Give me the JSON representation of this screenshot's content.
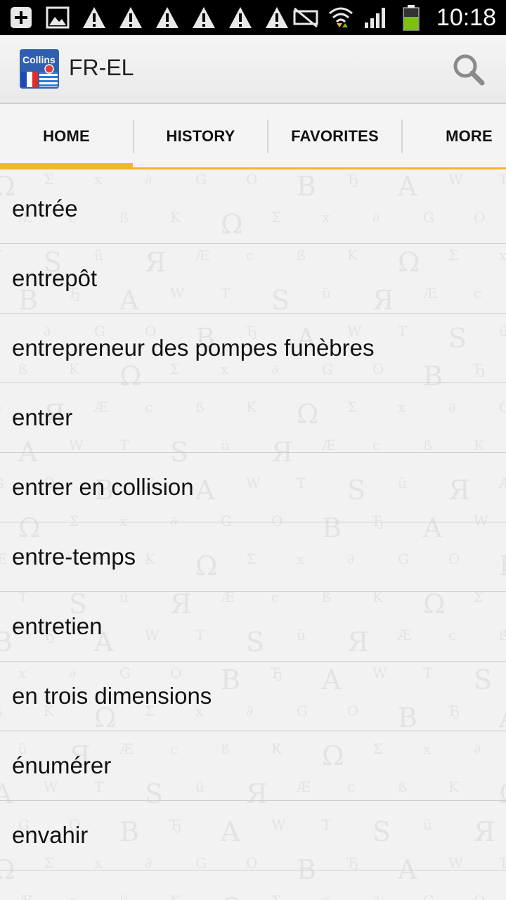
{
  "status_bar": {
    "time": "10:18",
    "left_icons": [
      "add-box-icon",
      "image-icon",
      "warning-icon",
      "warning-icon",
      "warning-icon",
      "warning-icon",
      "warning-icon",
      "warning-icon"
    ],
    "right_icons": [
      "silent-mode-icon",
      "wifi-icon",
      "signal-icon",
      "battery-icon"
    ],
    "colors": {
      "background": "#000000",
      "battery": "#7dc113"
    }
  },
  "action_bar": {
    "app_icon_text": "Collins",
    "title": "FR-EL",
    "search_icon": "search-icon"
  },
  "tabs": [
    {
      "label": "HOME",
      "selected": true
    },
    {
      "label": "HISTORY",
      "selected": false
    },
    {
      "label": "FAVORITES",
      "selected": false
    },
    {
      "label": "MORE",
      "selected": false
    }
  ],
  "accent_color": "#f7b52b",
  "words": [
    "entrée",
    "entrepôt",
    "entrepreneur des pompes funèbres",
    "entrer",
    "entrer en collision",
    "entre-temps",
    "entretien",
    "en trois dimensions",
    "énumérer",
    "envahir"
  ]
}
